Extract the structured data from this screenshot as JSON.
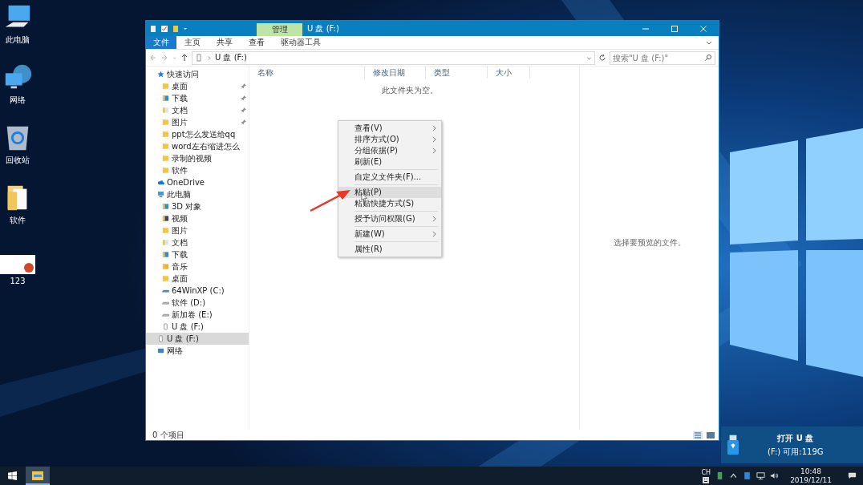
{
  "desktop_icons": [
    {
      "label": "此电脑",
      "kind": "computer"
    },
    {
      "label": "网络",
      "kind": "network"
    },
    {
      "label": "回收站",
      "kind": "recycle"
    },
    {
      "label": "软件",
      "kind": "folder"
    },
    {
      "label": "123",
      "kind": "slide"
    }
  ],
  "explorer": {
    "title": "U 盘 (F:)",
    "context_tab": "管理",
    "ribbon_tabs": [
      {
        "label": "文件",
        "kind": "file",
        "selected": false
      },
      {
        "label": "主页",
        "kind": "tab",
        "selected": false
      },
      {
        "label": "共享",
        "kind": "tab",
        "selected": false
      },
      {
        "label": "查看",
        "kind": "tab",
        "selected": false
      },
      {
        "label": "驱动器工具",
        "kind": "tab",
        "selected": false
      }
    ],
    "address": "U 盘 (F:)",
    "search": {
      "placeholder": "搜索\"U 盘 (F:)\""
    },
    "columns": [
      "名称",
      "修改日期",
      "类型",
      "大小"
    ],
    "empty_message": "此文件夹为空。",
    "sidebar": {
      "items": [
        {
          "label": "快速访问",
          "kind": "star",
          "selected": false,
          "children": [
            {
              "label": "桌面",
              "kind": "folder",
              "pinned": true,
              "selected": false
            },
            {
              "label": "下载",
              "kind": "download",
              "pinned": true,
              "selected": false
            },
            {
              "label": "文档",
              "kind": "doc",
              "pinned": true,
              "selected": false
            },
            {
              "label": "图片",
              "kind": "folder",
              "pinned": true,
              "selected": false
            },
            {
              "label": "ppt怎么发送给qq",
              "kind": "folder",
              "pinned": false,
              "selected": false
            },
            {
              "label": "word左右缩进怎么",
              "kind": "folder",
              "pinned": false,
              "selected": false
            },
            {
              "label": "录制的视频",
              "kind": "folder",
              "pinned": false,
              "selected": false
            },
            {
              "label": "软件",
              "kind": "folder",
              "pinned": false,
              "selected": false
            }
          ]
        },
        {
          "label": "OneDrive",
          "kind": "cloud",
          "selected": false
        },
        {
          "label": "此电脑",
          "kind": "computer",
          "selected": false,
          "children": [
            {
              "label": "3D 对象",
              "kind": "download",
              "selected": false
            },
            {
              "label": "视频",
              "kind": "video",
              "selected": false
            },
            {
              "label": "图片",
              "kind": "folder",
              "selected": false
            },
            {
              "label": "文档",
              "kind": "doc",
              "selected": false
            },
            {
              "label": "下载",
              "kind": "download",
              "selected": false
            },
            {
              "label": "音乐",
              "kind": "music",
              "selected": false
            },
            {
              "label": "桌面",
              "kind": "folder",
              "selected": false
            },
            {
              "label": "64WinXP  (C:)",
              "kind": "system",
              "selected": false
            },
            {
              "label": "软件 (D:)",
              "kind": "drive",
              "selected": false
            },
            {
              "label": "新加卷 (E:)",
              "kind": "drive",
              "selected": false
            },
            {
              "label": "U 盘 (F:)",
              "kind": "usb",
              "selected": false
            }
          ]
        },
        {
          "label": "U 盘 (F:)",
          "kind": "usb",
          "selected": true
        },
        {
          "label": "网络",
          "kind": "network",
          "selected": false
        }
      ]
    },
    "preview_message": "选择要预览的文件。",
    "status": "0 个项目"
  },
  "context_menu": {
    "groups": [
      [
        {
          "label": "查看(V)",
          "submenu": true,
          "selected": false
        },
        {
          "label": "排序方式(O)",
          "submenu": true,
          "selected": false
        },
        {
          "label": "分组依据(P)",
          "submenu": true,
          "selected": false
        },
        {
          "label": "刷新(E)",
          "submenu": false,
          "selected": false
        }
      ],
      [
        {
          "label": "自定义文件夹(F)...",
          "submenu": false,
          "selected": false
        }
      ],
      [
        {
          "label": "粘贴(P)",
          "submenu": false,
          "selected": true
        },
        {
          "label": "粘贴快捷方式(S)",
          "submenu": false,
          "selected": false
        }
      ],
      [
        {
          "label": "授予访问权限(G)",
          "submenu": true,
          "selected": false
        }
      ],
      [
        {
          "label": "新建(W)",
          "submenu": true,
          "selected": false
        }
      ],
      [
        {
          "label": "属性(R)",
          "submenu": false,
          "selected": false
        }
      ]
    ]
  },
  "notification": {
    "title": "打开 U 盘",
    "detail": "(F:)  可用:119G"
  },
  "taskbar": {
    "ime": "CH",
    "time": "10:48",
    "date": "2019/12/11"
  }
}
